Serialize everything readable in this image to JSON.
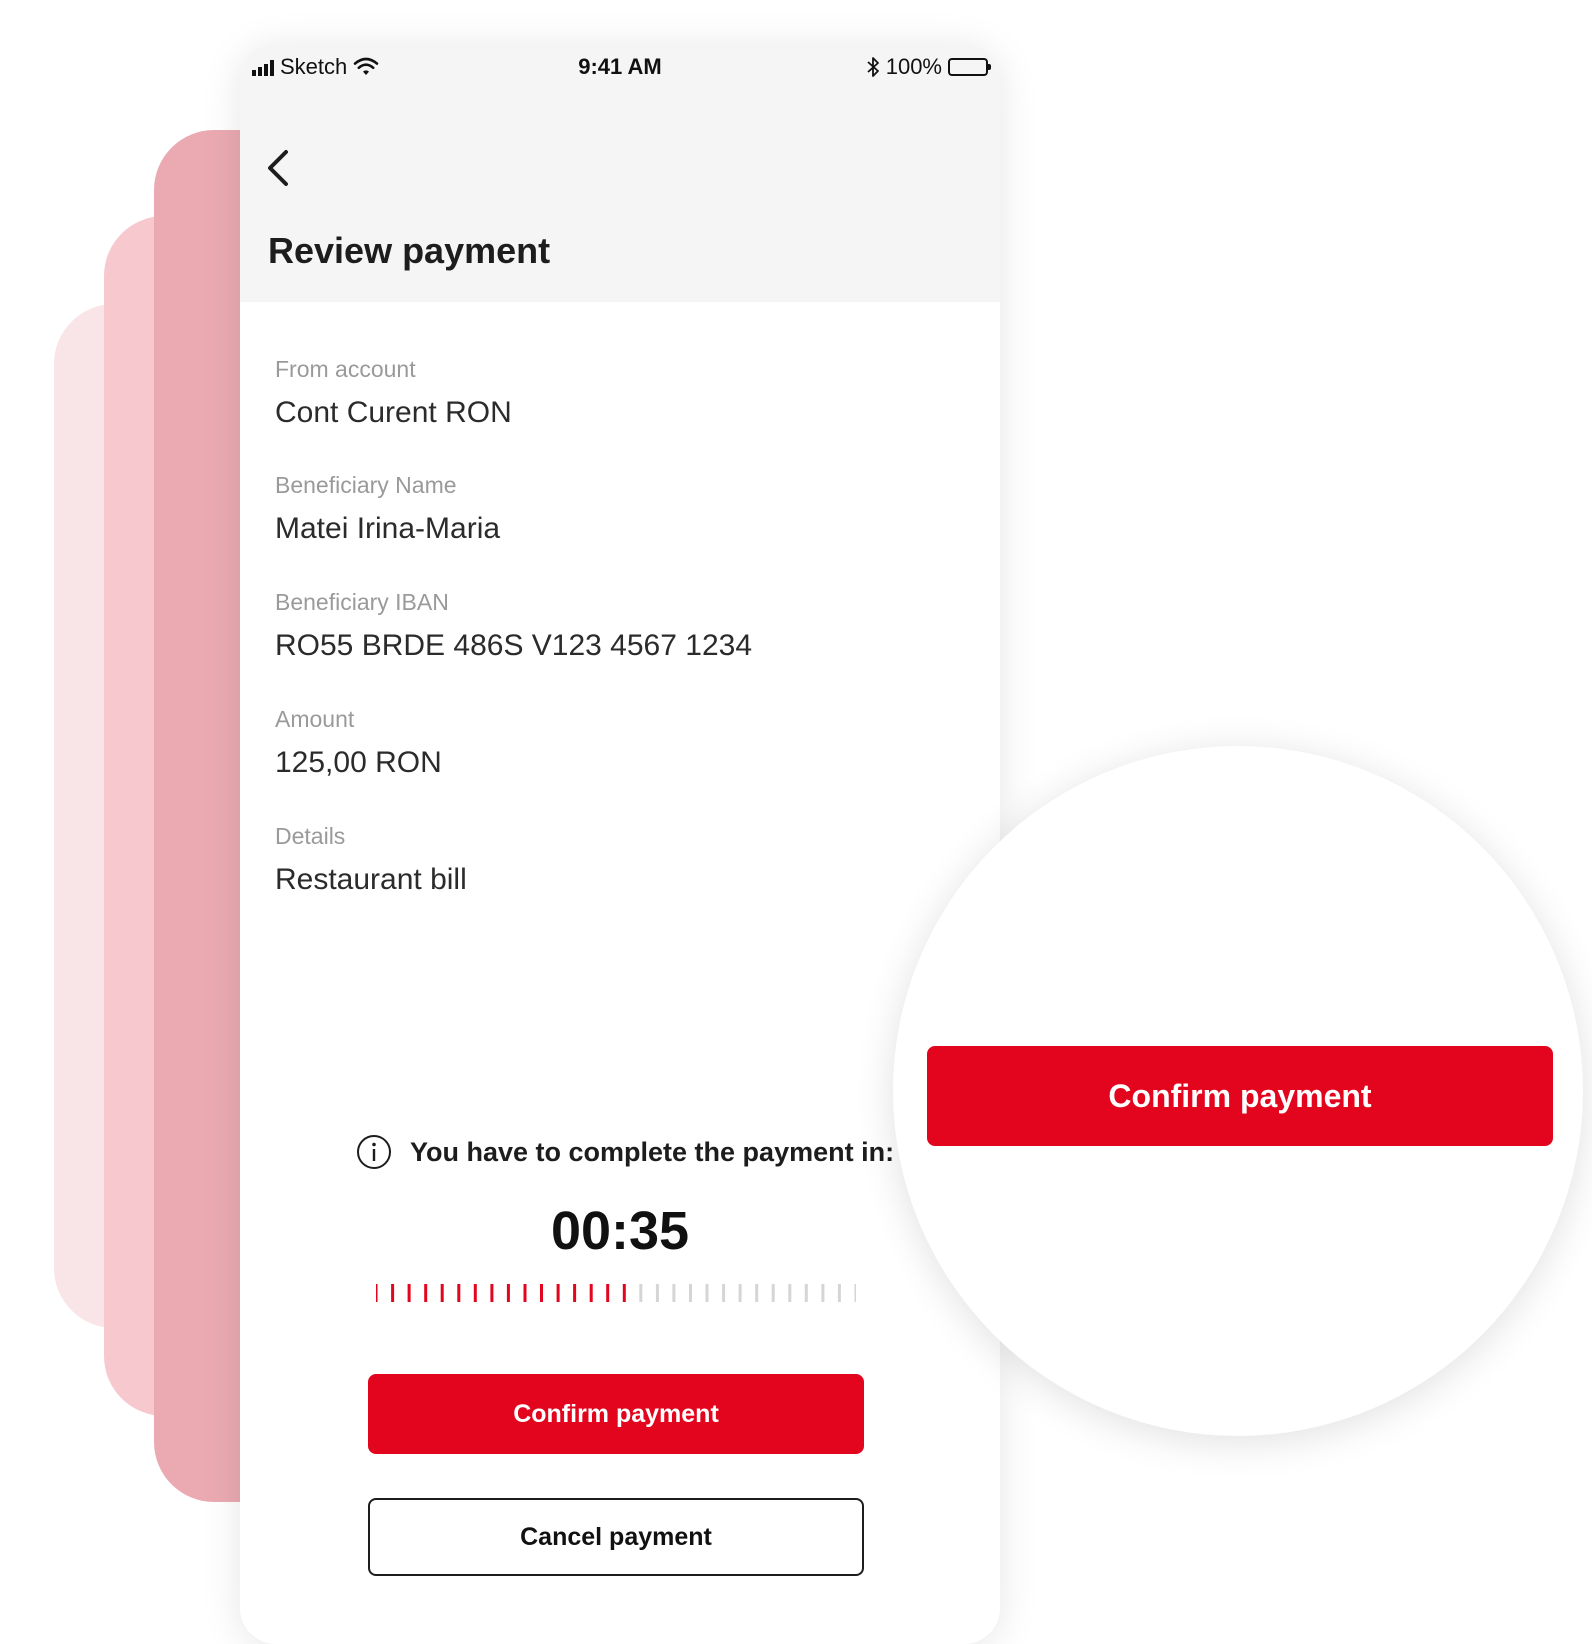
{
  "status_bar": {
    "carrier": "Sketch",
    "time": "9:41 AM",
    "battery": "100%"
  },
  "header": {
    "title": "Review payment"
  },
  "fields": [
    {
      "label": "From account",
      "value": "Cont Curent RON"
    },
    {
      "label": "Beneficiary Name",
      "value": "Matei Irina-Maria"
    },
    {
      "label": "Beneficiary IBAN",
      "value": "RO55 BRDE 486S V123 4567 1234"
    },
    {
      "label": "Amount",
      "value": "125,00 RON"
    },
    {
      "label": "Details",
      "value": "Restaurant bill"
    }
  ],
  "countdown": {
    "message": "You have to complete the payment in:",
    "time": "00:35",
    "progress_fraction": 0.53
  },
  "actions": {
    "confirm_label": "Confirm payment",
    "cancel_label": "Cancel payment"
  },
  "zoom": {
    "confirm_label": "Confirm payment"
  },
  "colors": {
    "accent": "#e3051d",
    "tick_inactive": "#d5d5d5"
  }
}
